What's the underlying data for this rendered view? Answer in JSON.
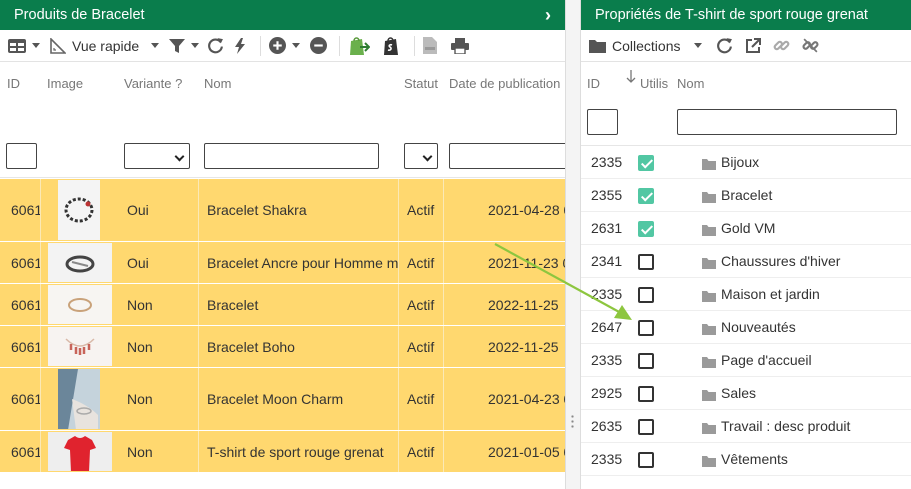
{
  "left_panel": {
    "title": "Produits de Bracelet",
    "toolbar": {
      "view_label": "Vue rapide"
    },
    "columns": {
      "id": "ID",
      "image": "Image",
      "variant": "Variante ?",
      "name": "Nom",
      "status": "Statut",
      "published": "Date de publication"
    },
    "rows": [
      {
        "id": "6061",
        "variant": "Oui",
        "name": "Bracelet Shakra",
        "status": "Actif",
        "published": "2021-04-28 0"
      },
      {
        "id": "6061",
        "variant": "Oui",
        "name": "Bracelet Ancre pour Homme m",
        "status": "Actif",
        "published": "2021-11-23 0"
      },
      {
        "id": "6061",
        "variant": "Non",
        "name": "Bracelet",
        "status": "Actif",
        "published": "2022-11-25"
      },
      {
        "id": "6061",
        "variant": "Non",
        "name": "Bracelet Boho",
        "status": "Actif",
        "published": "2022-11-25"
      },
      {
        "id": "6061",
        "variant": "Non",
        "name": "Bracelet Moon Charm",
        "status": "Actif",
        "published": "2021-04-23 0"
      },
      {
        "id": "6061",
        "variant": "Non",
        "name": "T-shirt de sport rouge grenat",
        "status": "Actif",
        "published": "2021-01-05 0"
      }
    ]
  },
  "right_panel": {
    "title": "Propriétés de T-shirt de sport rouge grenat",
    "toolbar": {
      "collections_label": "Collections"
    },
    "columns": {
      "id": "ID",
      "used": "Utilis",
      "name": "Nom"
    },
    "rows": [
      {
        "id": "2335",
        "checked": true,
        "name": "Bijoux"
      },
      {
        "id": "2355",
        "checked": true,
        "name": "Bracelet"
      },
      {
        "id": "2631",
        "checked": true,
        "name": "Gold VM"
      },
      {
        "id": "2341",
        "checked": false,
        "name": "Chaussures d'hiver"
      },
      {
        "id": "2335",
        "checked": false,
        "name": "Maison et jardin"
      },
      {
        "id": "2647",
        "checked": false,
        "name": "Nouveautés"
      },
      {
        "id": "2335",
        "checked": false,
        "name": "Page d'accueil"
      },
      {
        "id": "2925",
        "checked": false,
        "name": "Sales"
      },
      {
        "id": "2635",
        "checked": false,
        "name": "Travail : desc produit"
      },
      {
        "id": "2335",
        "checked": false,
        "name": "Vêtements"
      }
    ]
  },
  "colors": {
    "header": "#0a7d4c",
    "row_highlight": "#ffd86f",
    "checkbox_on": "#52c7a3",
    "annotation_arrow": "#8dc63f"
  },
  "icons": [
    "grid-icon",
    "ruler-icon",
    "filter-icon",
    "refresh-icon",
    "bolt-icon",
    "add-icon",
    "remove-icon",
    "shopify-export-icon",
    "shopify-icon",
    "csv-icon",
    "print-icon",
    "folder-icon",
    "external-link-icon",
    "link-icon",
    "unlink-icon",
    "sort-down-icon"
  ]
}
